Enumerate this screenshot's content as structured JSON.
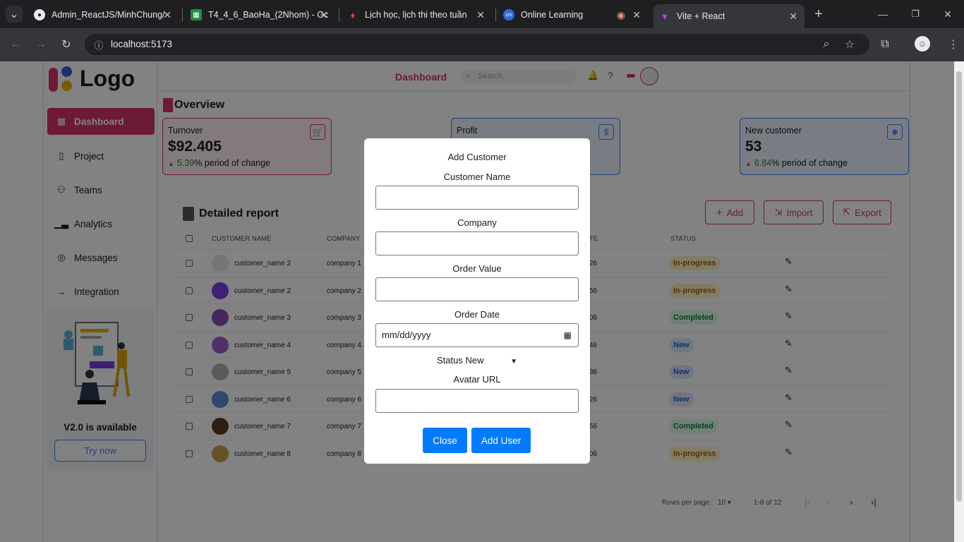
{
  "browser": {
    "tabs": [
      {
        "title": "Admin_ReactJS/MinhChung/",
        "icon": "github-icon"
      },
      {
        "title": "T4_4_6_BaoHa_(2Nhom) - Gc",
        "icon": "sheets-icon"
      },
      {
        "title": "Lịch học, lịch thi theo tuần",
        "icon": "school-icon"
      },
      {
        "title": "Online Learning",
        "icon": "zoom-icon"
      },
      {
        "title": "Vite + React",
        "icon": "vite-icon"
      }
    ],
    "new_tab": "+",
    "url": "localhost:5173"
  },
  "sidebar": {
    "logo_text": "Logo",
    "items": [
      {
        "label": "Dashboard",
        "icon": "grid-icon"
      },
      {
        "label": "Project",
        "icon": "file-icon"
      },
      {
        "label": "Teams",
        "icon": "users-icon"
      },
      {
        "label": "Analytics",
        "icon": "chart-icon"
      },
      {
        "label": "Messages",
        "icon": "message-icon"
      },
      {
        "label": "Integration",
        "icon": "plug-icon"
      }
    ],
    "promo_title": "V2.0 is available",
    "promo_button": "Try now"
  },
  "header": {
    "title": "Dashboard",
    "search_placeholder": "Search..."
  },
  "overview": {
    "title": "Overview",
    "cards": [
      {
        "label": "Turnover",
        "value": "$92.405",
        "pct": "5.39",
        "suffix": "% period of change"
      },
      {
        "label": "Profit",
        "value": "",
        "pct": "",
        "suffix": ""
      },
      {
        "label": "New customer",
        "value": "53",
        "pct": "6.84",
        "suffix": "% period of change"
      }
    ]
  },
  "report": {
    "title": "Detailed report",
    "buttons": {
      "add": "Add",
      "import": "Import",
      "export": "Export"
    },
    "columns": {
      "name": "CUSTOMER NAME",
      "company": "COMPANY",
      "date_fragment": "TE",
      "status": "STATUS"
    },
    "rows": [
      {
        "name": "customer_name 2",
        "company": "company 1",
        "date": "26",
        "status": "In-progress"
      },
      {
        "name": "customer_name 2",
        "company": "company 2",
        "date": "56",
        "status": "In-progress"
      },
      {
        "name": "customer_name 3",
        "company": "company 3",
        "date": "06",
        "status": "Completed"
      },
      {
        "name": "customer_name 4",
        "company": "company 4",
        "date": "46",
        "status": "New"
      },
      {
        "name": "customer_name 5",
        "company": "company 5",
        "date": "36",
        "status": "New"
      },
      {
        "name": "customer_name 6",
        "company": "company 6",
        "date": "26",
        "status": "New"
      },
      {
        "name": "customer_name 7",
        "company": "company 7",
        "date": "56",
        "status": "Completed"
      },
      {
        "name": "customer_name 8",
        "company": "company 8",
        "date": "06",
        "status": "In-progress"
      }
    ],
    "pager": {
      "rows_label": "Rows per page:",
      "rows_value": "10",
      "range": "1-8 of 12"
    }
  },
  "modal": {
    "title": "Add Customer",
    "name_label": "Customer Name",
    "company_label": "Company",
    "order_value_label": "Order Value",
    "order_date_label": "Order Date",
    "order_date_placeholder": "mm/dd/yyyy",
    "status_label": "Status",
    "status_value": "New",
    "avatar_label": "Avatar URL",
    "close_label": "Close",
    "add_label": "Add User"
  },
  "colors": {
    "accent": "#d6336c",
    "primary_button": "#007bff"
  }
}
